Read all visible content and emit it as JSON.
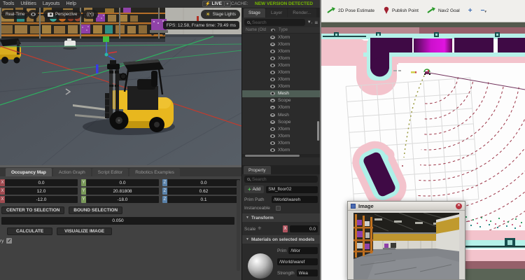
{
  "isaac": {
    "menu": [
      "Tools",
      "Utilities",
      "Layouts",
      "Help"
    ],
    "live_label": "LIVE",
    "cache_label": "CACHE:",
    "version_banner": "NEW VERSION DETECTED",
    "viewport": {
      "realtime": "Real-Time",
      "perspective": "Perspective",
      "lights_toggle": "((•))",
      "stage_lights": "Stage Lights",
      "fps_tooltip": "FPS: 12.58, Frame time: 79.49 ms"
    },
    "stage": {
      "tabs": [
        "Stage",
        "Layer",
        "Render..."
      ],
      "search_placeholder": "Search",
      "col_name": "Name (Old",
      "col_type": "Type",
      "rows": [
        "Xform",
        "Xform",
        "Xform",
        "Xform",
        "Xform",
        "Xform",
        "Xform",
        "Xform",
        "Mesh",
        "Scope",
        "Xform",
        "Mesh",
        "Scope",
        "Xform",
        "Xform",
        "Xform",
        "Xform"
      ],
      "selected_index": 8
    },
    "property": {
      "tab": "Property",
      "search_placeholder": "Search",
      "add_label": "Add",
      "name_value": "SM_floor02",
      "prim_path_label": "Prim Path",
      "prim_path_value": "/World/wareh",
      "instanceable_label": "Instanceable",
      "transform_section": "Transform",
      "scale_label": "Scale",
      "scale_axis": "X",
      "scale_value": "0.0",
      "materials_section": "Materials on selected models",
      "prim_label": "Prim",
      "prim_value": "/Wor",
      "material_path": "/World/waref",
      "strength_label": "Strength",
      "strength_value": "Wea"
    },
    "occupancy": {
      "tabs": [
        "Occupancy Map",
        "Action Graph",
        "Script Editor",
        "Robotics Examples"
      ],
      "active_tab": 0,
      "axes": [
        "X",
        "Y",
        "Z"
      ],
      "axis_colors": {
        "X": "#a04a50",
        "Y": "#7a9a5a",
        "Z": "#5a82aa"
      },
      "rows": [
        [
          "0.0",
          "0.0",
          "0.0"
        ],
        [
          "12.0",
          "20.81808",
          "0.62"
        ],
        [
          "-12.0",
          "-18.0",
          "0.1"
        ]
      ],
      "buttons_row1": [
        "CENTER TO SELECTION",
        "BOUND SELECTION"
      ],
      "cell_size": "0.050",
      "buttons_row2": [
        "CALCULATE",
        "VISUALIZE IMAGE"
      ],
      "checkbox_label": "ry",
      "checkbox_checked": true
    }
  },
  "rviz": {
    "toolbar": [
      {
        "label": "2D Pose Estimate",
        "icon": "pose-arrow"
      },
      {
        "label": "Publish Point",
        "icon": "pin"
      },
      {
        "label": "Nav2 Goal",
        "icon": "goal-arrow"
      },
      {
        "label": "+",
        "icon": "plus"
      },
      {
        "label": "−",
        "icon": "minus"
      }
    ],
    "image_panel": {
      "title": "Image"
    },
    "map_colors": {
      "free": "#fdfdfd",
      "occupied": "#3f0a45",
      "inflation": "#f3c3cc",
      "cyan": "#b5f1e9",
      "magenta": "#cc10cc",
      "scan": "#9c3547",
      "rose": "#b8888f",
      "sage": "#545a4e"
    }
  }
}
